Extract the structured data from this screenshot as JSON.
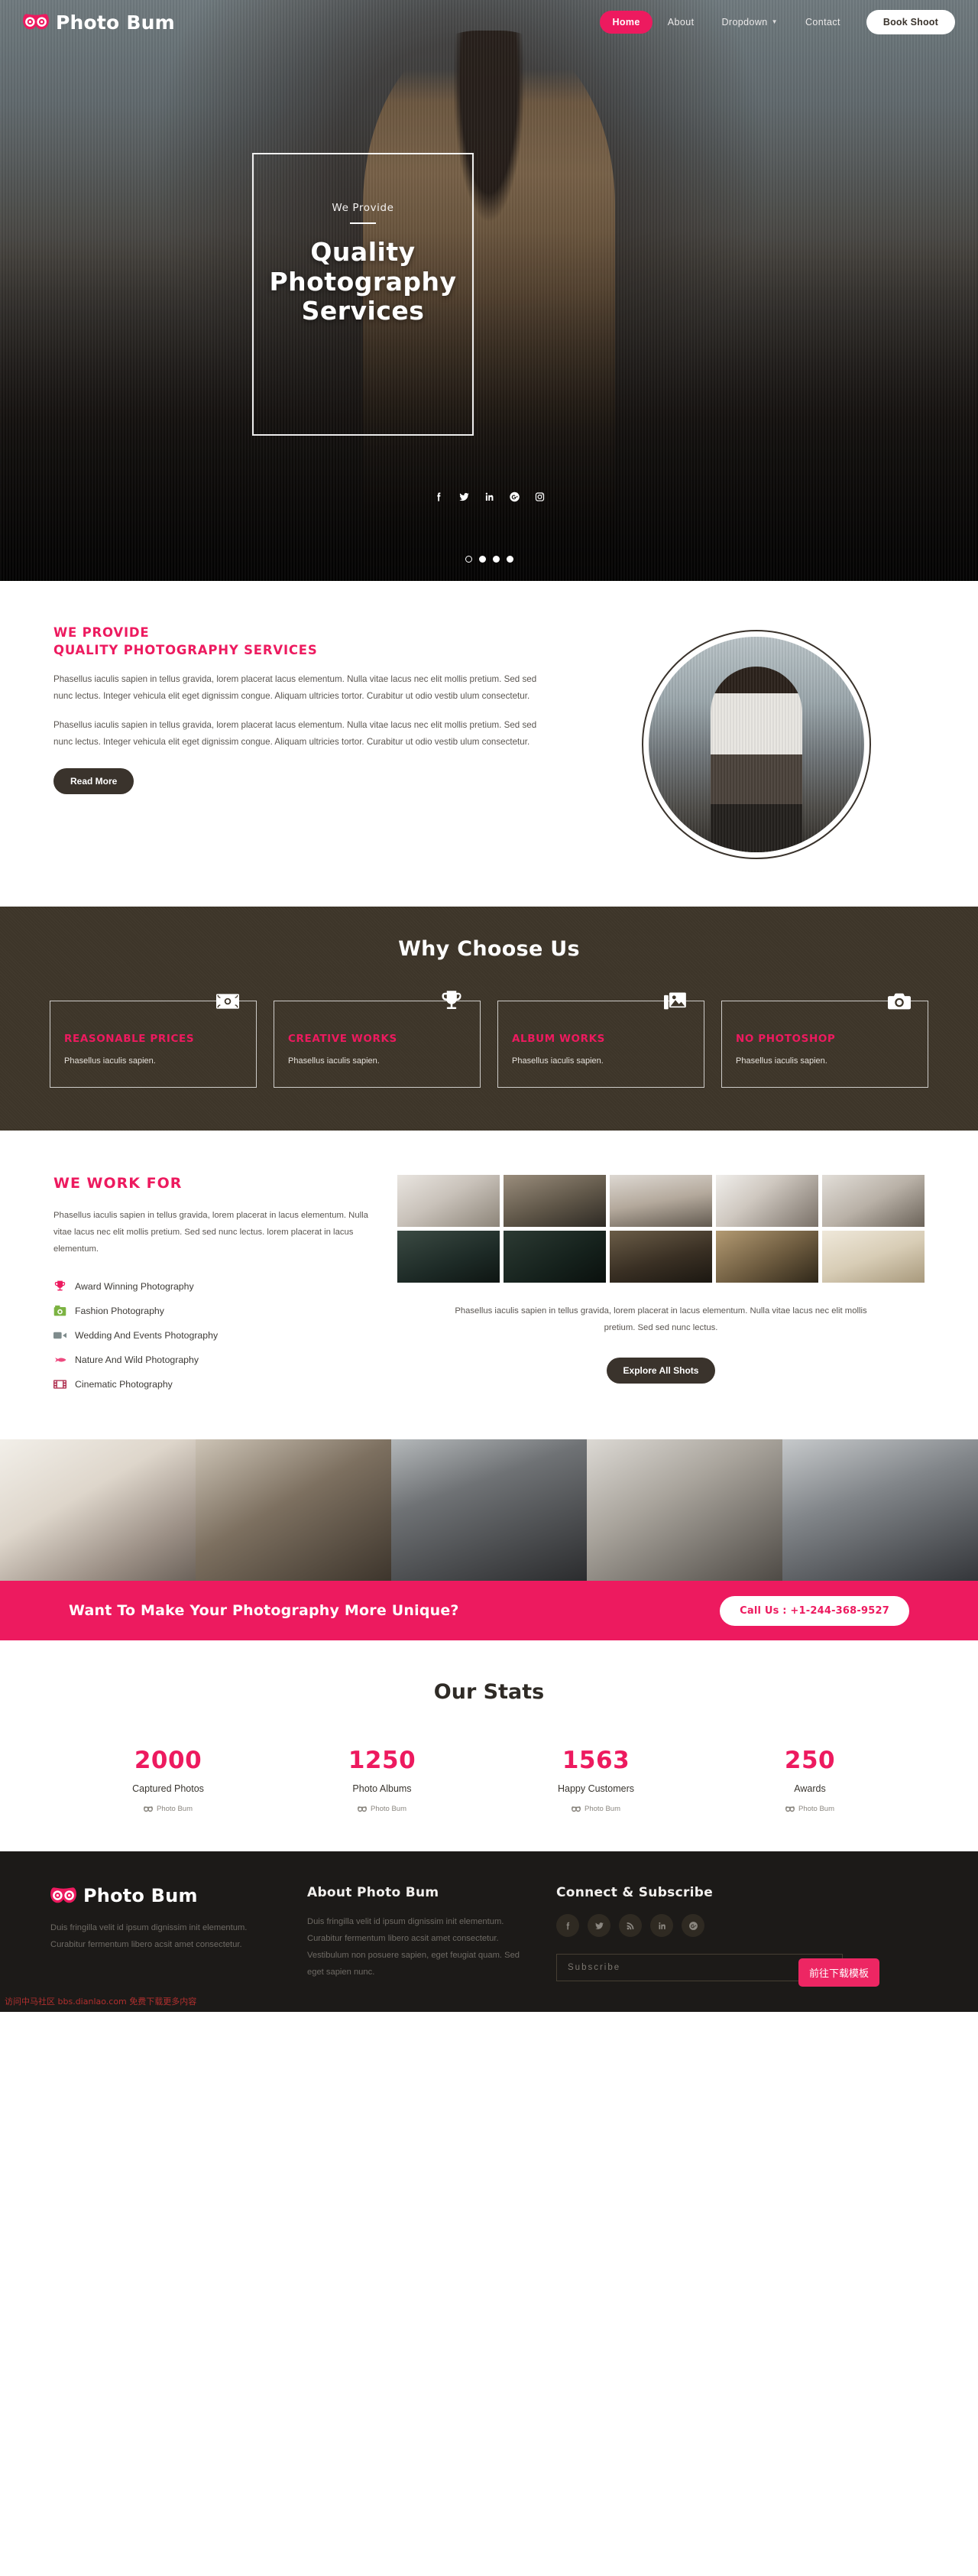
{
  "brand": {
    "name": "Photo Bum",
    "logo_icon": "owl-eyes-icon"
  },
  "nav": {
    "items": [
      {
        "label": "Home",
        "active": true
      },
      {
        "label": "About",
        "active": false
      },
      {
        "label": "Dropdown",
        "active": false,
        "has_caret": true
      },
      {
        "label": "Contact",
        "active": false
      }
    ],
    "cta_label": "Book Shoot"
  },
  "hero": {
    "kicker": "We Provide",
    "title_line1": "Quality",
    "title_line2": "Photography",
    "title_line3": "Services",
    "socials": [
      "facebook-icon",
      "twitter-icon",
      "linkedin-icon",
      "google-plus-icon",
      "instagram-icon"
    ],
    "dots": 4,
    "active_dot": 0
  },
  "provide": {
    "eyebrow": "WE PROVIDE",
    "heading": "QUALITY PHOTOGRAPHY SERVICES",
    "paragraph1": "Phasellus iaculis sapien in tellus gravida, lorem placerat lacus elementum. Nulla vitae lacus nec elit mollis pretium. Sed sed nunc lectus. Integer vehicula elit eget dignissim congue. Aliquam ultricies tortor. Curabitur ut odio vestib ulum consectetur.",
    "paragraph2": "Phasellus iaculis sapien in tellus gravida, lorem placerat lacus elementum. Nulla vitae lacus nec elit mollis pretium. Sed sed nunc lectus. Integer vehicula elit eget dignissim congue. Aliquam ultricies tortor. Curabitur ut odio vestib ulum consectetur.",
    "button_label": "Read More"
  },
  "why": {
    "title": "Why Choose Us",
    "cards": [
      {
        "title": "REASONABLE PRICES",
        "text": "Phasellus iaculis sapien.",
        "icon": "money-bill-icon"
      },
      {
        "title": "CREATIVE WORKS",
        "text": "Phasellus iaculis sapien.",
        "icon": "trophy-icon"
      },
      {
        "title": "ALBUM WORKS",
        "text": "Phasellus iaculis sapien.",
        "icon": "photo-stack-icon"
      },
      {
        "title": "NO PHOTOSHOP",
        "text": "Phasellus iaculis sapien.",
        "icon": "camera-icon"
      }
    ]
  },
  "work": {
    "eyebrow": "WE WORK FOR",
    "paragraph": "Phasellus iaculis sapien in tellus gravida, lorem placerat in lacus elementum. Nulla vitae lacus nec elit mollis pretium. Sed sed nunc lectus. lorem placerat in lacus elementum.",
    "list": [
      {
        "label": "Award Winning Photography",
        "icon": "trophy-icon",
        "color": "#ed1a5f"
      },
      {
        "label": "Fashion Photography",
        "icon": "vintage-camera-icon",
        "color": "#7cb342"
      },
      {
        "label": "Wedding And Events Photography",
        "icon": "video-camera-icon",
        "color": "#7f8c8d"
      },
      {
        "label": "Nature And Wild Photography",
        "icon": "rocket-icon",
        "color": "#ed4a7f"
      },
      {
        "label": "Cinematic Photography",
        "icon": "film-strip-icon",
        "color": "#b03050"
      }
    ],
    "gallery_caption": "Phasellus iaculis sapien in tellus gravida, lorem placerat in lacus elementum. Nulla vitae lacus nec elit mollis pretium. Sed sed nunc lectus.",
    "gallery_button": "Explore All Shots"
  },
  "cta": {
    "text": "Want To Make Your Photography More Unique?",
    "button_label": "Call Us : +1-244-368-9527"
  },
  "stats": {
    "title": "Our Stats",
    "items": [
      {
        "number": "2000",
        "label": "Captured Photos",
        "sub": "Photo Bum"
      },
      {
        "number": "1250",
        "label": "Photo Albums",
        "sub": "Photo Bum"
      },
      {
        "number": "1563",
        "label": "Happy Customers",
        "sub": "Photo Bum"
      },
      {
        "number": "250",
        "label": "Awards",
        "sub": "Photo Bum"
      }
    ]
  },
  "footer": {
    "brand_name": "Photo Bum",
    "brand_text": "Duis fringilla velit id ipsum dignissim init elementum. Curabitur fermentum libero acsit amet consectetur.",
    "about_heading": "About Photo Bum",
    "about_text": "Duis fringilla velit id ipsum dignissim init elementum. Curabitur fermentum libero acsit amet consectetur. Vestibulum non posuere sapien, eget feugiat quam. Sed eget sapien nunc.",
    "connect_heading": "Connect & Subscribe",
    "socials": [
      "facebook-icon",
      "twitter-icon",
      "rss-icon",
      "linkedin-icon",
      "google-plus-icon"
    ],
    "subscribe_placeholder": "Subscribe",
    "subscribe_value": "",
    "download_button": "前往下载模板"
  },
  "watermark": "访问中马社区 bbs.dianlao.com 免费下载更多内容",
  "colors": {
    "accent": "#ed1a5f",
    "dark": "#3a332c",
    "brown": "#3d3529",
    "footer_bg": "#1c1a18"
  }
}
